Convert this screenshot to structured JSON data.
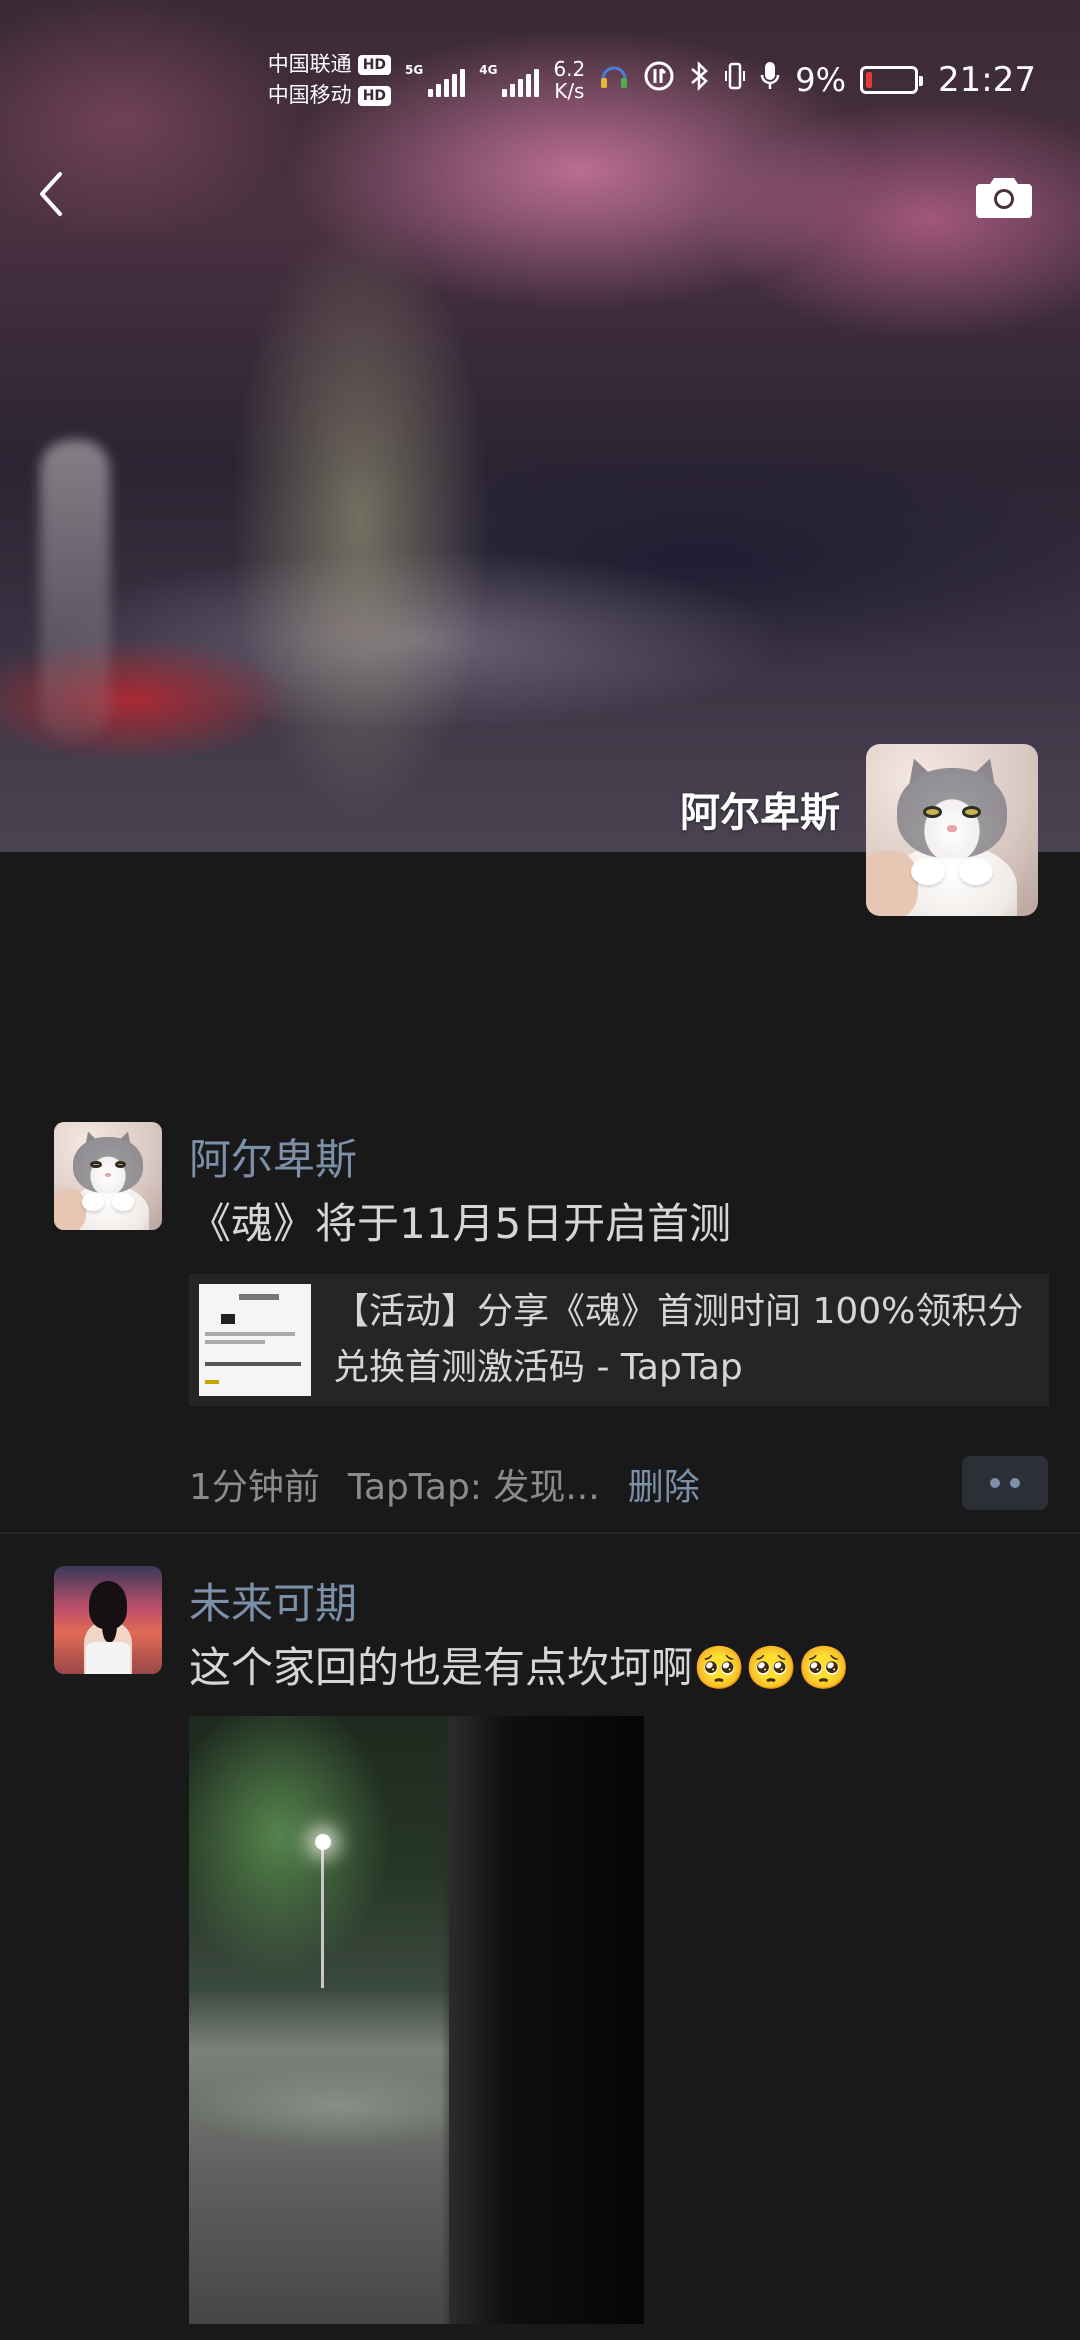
{
  "status_bar": {
    "carrier1": "中国联通",
    "carrier2": "中国移动",
    "hd_badge": "HD",
    "net1": "5G",
    "net2": "4G",
    "speed_value": "6.2",
    "speed_unit": "K/s",
    "battery": "9%",
    "time": "21:27"
  },
  "profile": {
    "name": "阿尔卑斯"
  },
  "posts": [
    {
      "author": "阿尔卑斯",
      "text": "《魂》将于11月5日开启首测",
      "link_title": "【活动】分享《魂》首测时间 100%领积分兑换首测激活码 - TapTap",
      "time": "1分钟前",
      "source": "TapTap: 发现...",
      "delete_label": "删除"
    },
    {
      "author": "未来可期",
      "text": "这个家回的也是有点坎坷啊🥺🥺🥺"
    }
  ]
}
